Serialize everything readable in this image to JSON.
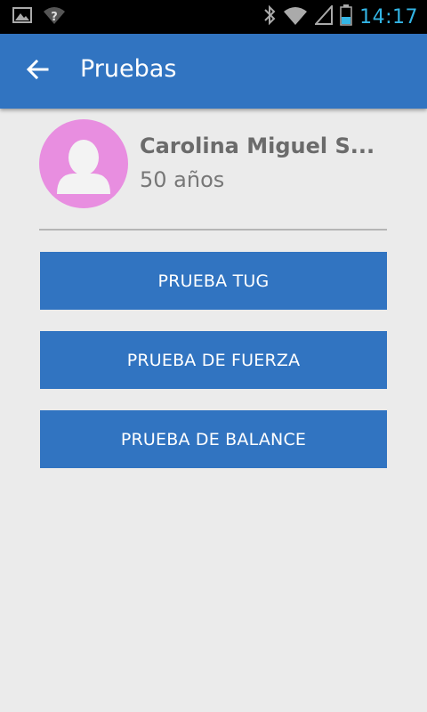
{
  "status_bar": {
    "time": "14:17",
    "icons": [
      "image-icon",
      "wifi-question-icon",
      "bluetooth-icon",
      "wifi-icon",
      "cell-signal-icon",
      "battery-icon"
    ],
    "time_color": "#33b5e5"
  },
  "app_bar": {
    "title": "Pruebas",
    "back_icon": "arrow-left-icon",
    "color": "#3174c1"
  },
  "profile": {
    "name": "Carolina Miguel S...",
    "age": "50 años",
    "avatar_icon": "person-icon",
    "avatar_color": "#e88ee0"
  },
  "buttons": [
    {
      "label": "PRUEBA TUG"
    },
    {
      "label": "PRUEBA DE FUERZA"
    },
    {
      "label": "PRUEBA DE BALANCE"
    }
  ]
}
